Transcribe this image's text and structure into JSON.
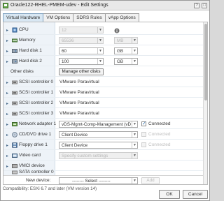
{
  "window": {
    "title": "Oracle122-RHEL-PMEM-udev - Edit Settings"
  },
  "tabs": [
    {
      "label": "Virtual Hardware"
    },
    {
      "label": "VM Options"
    },
    {
      "label": "SDRS Rules"
    },
    {
      "label": "vApp Options"
    }
  ],
  "rows": {
    "cpu": {
      "label": "CPU",
      "value": "12"
    },
    "memory": {
      "label": "Memory",
      "value": "65536",
      "unit": "MB"
    },
    "hd1": {
      "label": "Hard disk 1",
      "value": "60",
      "unit": "GB"
    },
    "hd2": {
      "label": "Hard disk 2",
      "value": "100",
      "unit": "GB"
    },
    "otherdisks": {
      "label": "Other disks",
      "button": "Manage other disks"
    },
    "scsi0": {
      "label": "SCSI controller 0",
      "value": "VMware Paravirtual"
    },
    "scsi1": {
      "label": "SCSI controller 1",
      "value": "VMware Paravirtual"
    },
    "scsi2": {
      "label": "SCSI controller 2",
      "value": "VMware Paravirtual"
    },
    "scsi3": {
      "label": "SCSI controller 3",
      "value": "VMware Paravirtual"
    },
    "net1": {
      "label": "Network adapter 1",
      "value": "vDS-Mgmt-Comp-Management (vDS",
      "status": "Connected"
    },
    "cd1": {
      "label": "CD/DVD drive 1",
      "value": "Client Device",
      "status": "Connected"
    },
    "floppy1": {
      "label": "Floppy drive 1",
      "value": "Client Device",
      "status": "Connected"
    },
    "video": {
      "label": "Video card",
      "value": "Specify custom settings"
    },
    "vmci": {
      "label": "VMCI device"
    },
    "sata0": {
      "label": "SATA controller 0"
    }
  },
  "newdevice": {
    "label": "New device:",
    "select": "-------- Select --------",
    "button": "Add"
  },
  "footer": {
    "compat": "Compatibility: ESXi 6.7 and later (VM version 14)",
    "ok": "OK",
    "cancel": "Cancel"
  }
}
